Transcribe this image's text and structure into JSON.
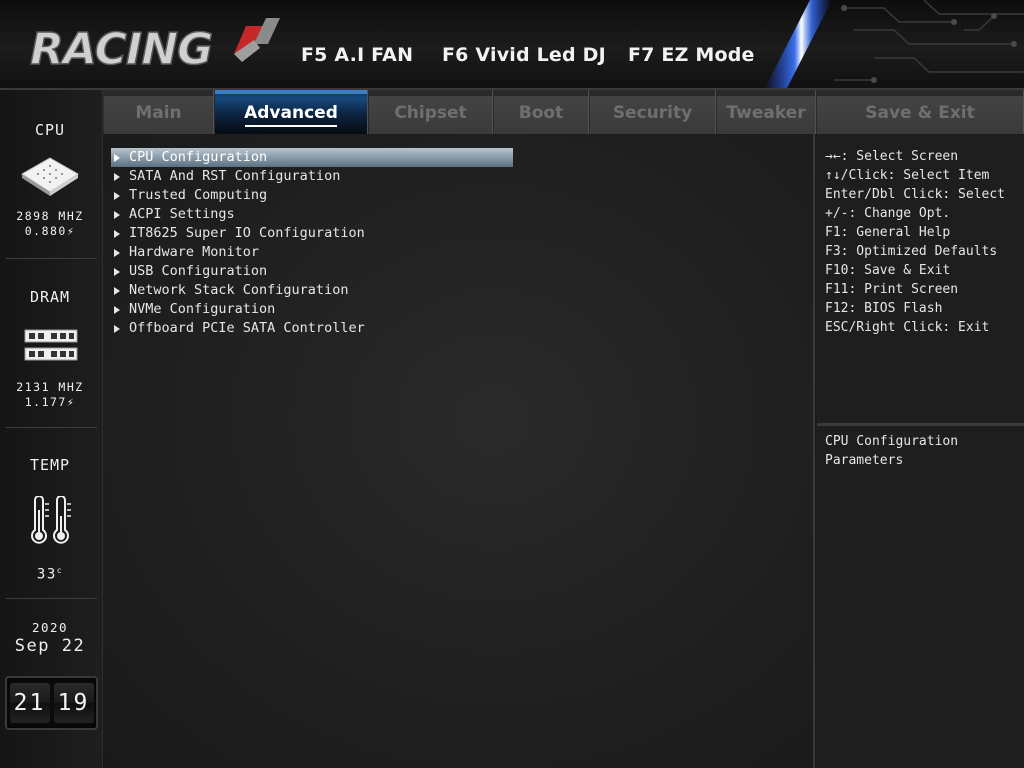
{
  "header": {
    "logo_text": "RACING",
    "hotkeys": [
      {
        "label": "F5 A.I FAN"
      },
      {
        "label": "F6 Vivid Led DJ"
      },
      {
        "label": "F7 EZ Mode"
      }
    ]
  },
  "status": {
    "cpu": {
      "title": "CPU",
      "freq": "2898 MHZ",
      "volt": "0.880"
    },
    "dram": {
      "title": "DRAM",
      "freq": "2131 MHZ",
      "volt": "1.177"
    },
    "temp": {
      "title": "TEMP",
      "value": "33",
      "unit": "c"
    },
    "date": {
      "year": "2020",
      "month_day": "Sep 22"
    },
    "clock": {
      "hours": "21",
      "minutes": "19"
    }
  },
  "tabs": [
    {
      "label": "Main",
      "active": false
    },
    {
      "label": "Advanced",
      "active": true
    },
    {
      "label": "Chipset",
      "active": false
    },
    {
      "label": "Boot",
      "active": false
    },
    {
      "label": "Security",
      "active": false
    },
    {
      "label": "Tweaker",
      "active": false
    },
    {
      "label": "Save & Exit",
      "active": false
    }
  ],
  "menu": {
    "items": [
      {
        "label": "CPU Configuration",
        "selected": true
      },
      {
        "label": "SATA And RST Configuration",
        "selected": false
      },
      {
        "label": "Trusted Computing",
        "selected": false
      },
      {
        "label": "ACPI Settings",
        "selected": false
      },
      {
        "label": "IT8625 Super IO Configuration",
        "selected": false
      },
      {
        "label": "Hardware Monitor",
        "selected": false
      },
      {
        "label": "USB Configuration",
        "selected": false
      },
      {
        "label": "Network Stack Configuration",
        "selected": false
      },
      {
        "label": "NVMe Configuration",
        "selected": false
      },
      {
        "label": "Offboard PCIe SATA Controller",
        "selected": false
      }
    ]
  },
  "help": {
    "keys": [
      "→←: Select Screen",
      "↑↓/Click: Select Item",
      "Enter/Dbl Click: Select",
      "+/-: Change Opt.",
      "F1: General Help",
      "F3: Optimized Defaults",
      "F10: Save & Exit",
      "F11: Print Screen",
      "F12: BIOS Flash",
      "ESC/Right Click: Exit"
    ],
    "description": [
      "CPU Configuration",
      "Parameters"
    ]
  },
  "colors": {
    "accent_blue": "#17497d",
    "selection": "#8fa0ad",
    "logo_red": "#c62828"
  }
}
